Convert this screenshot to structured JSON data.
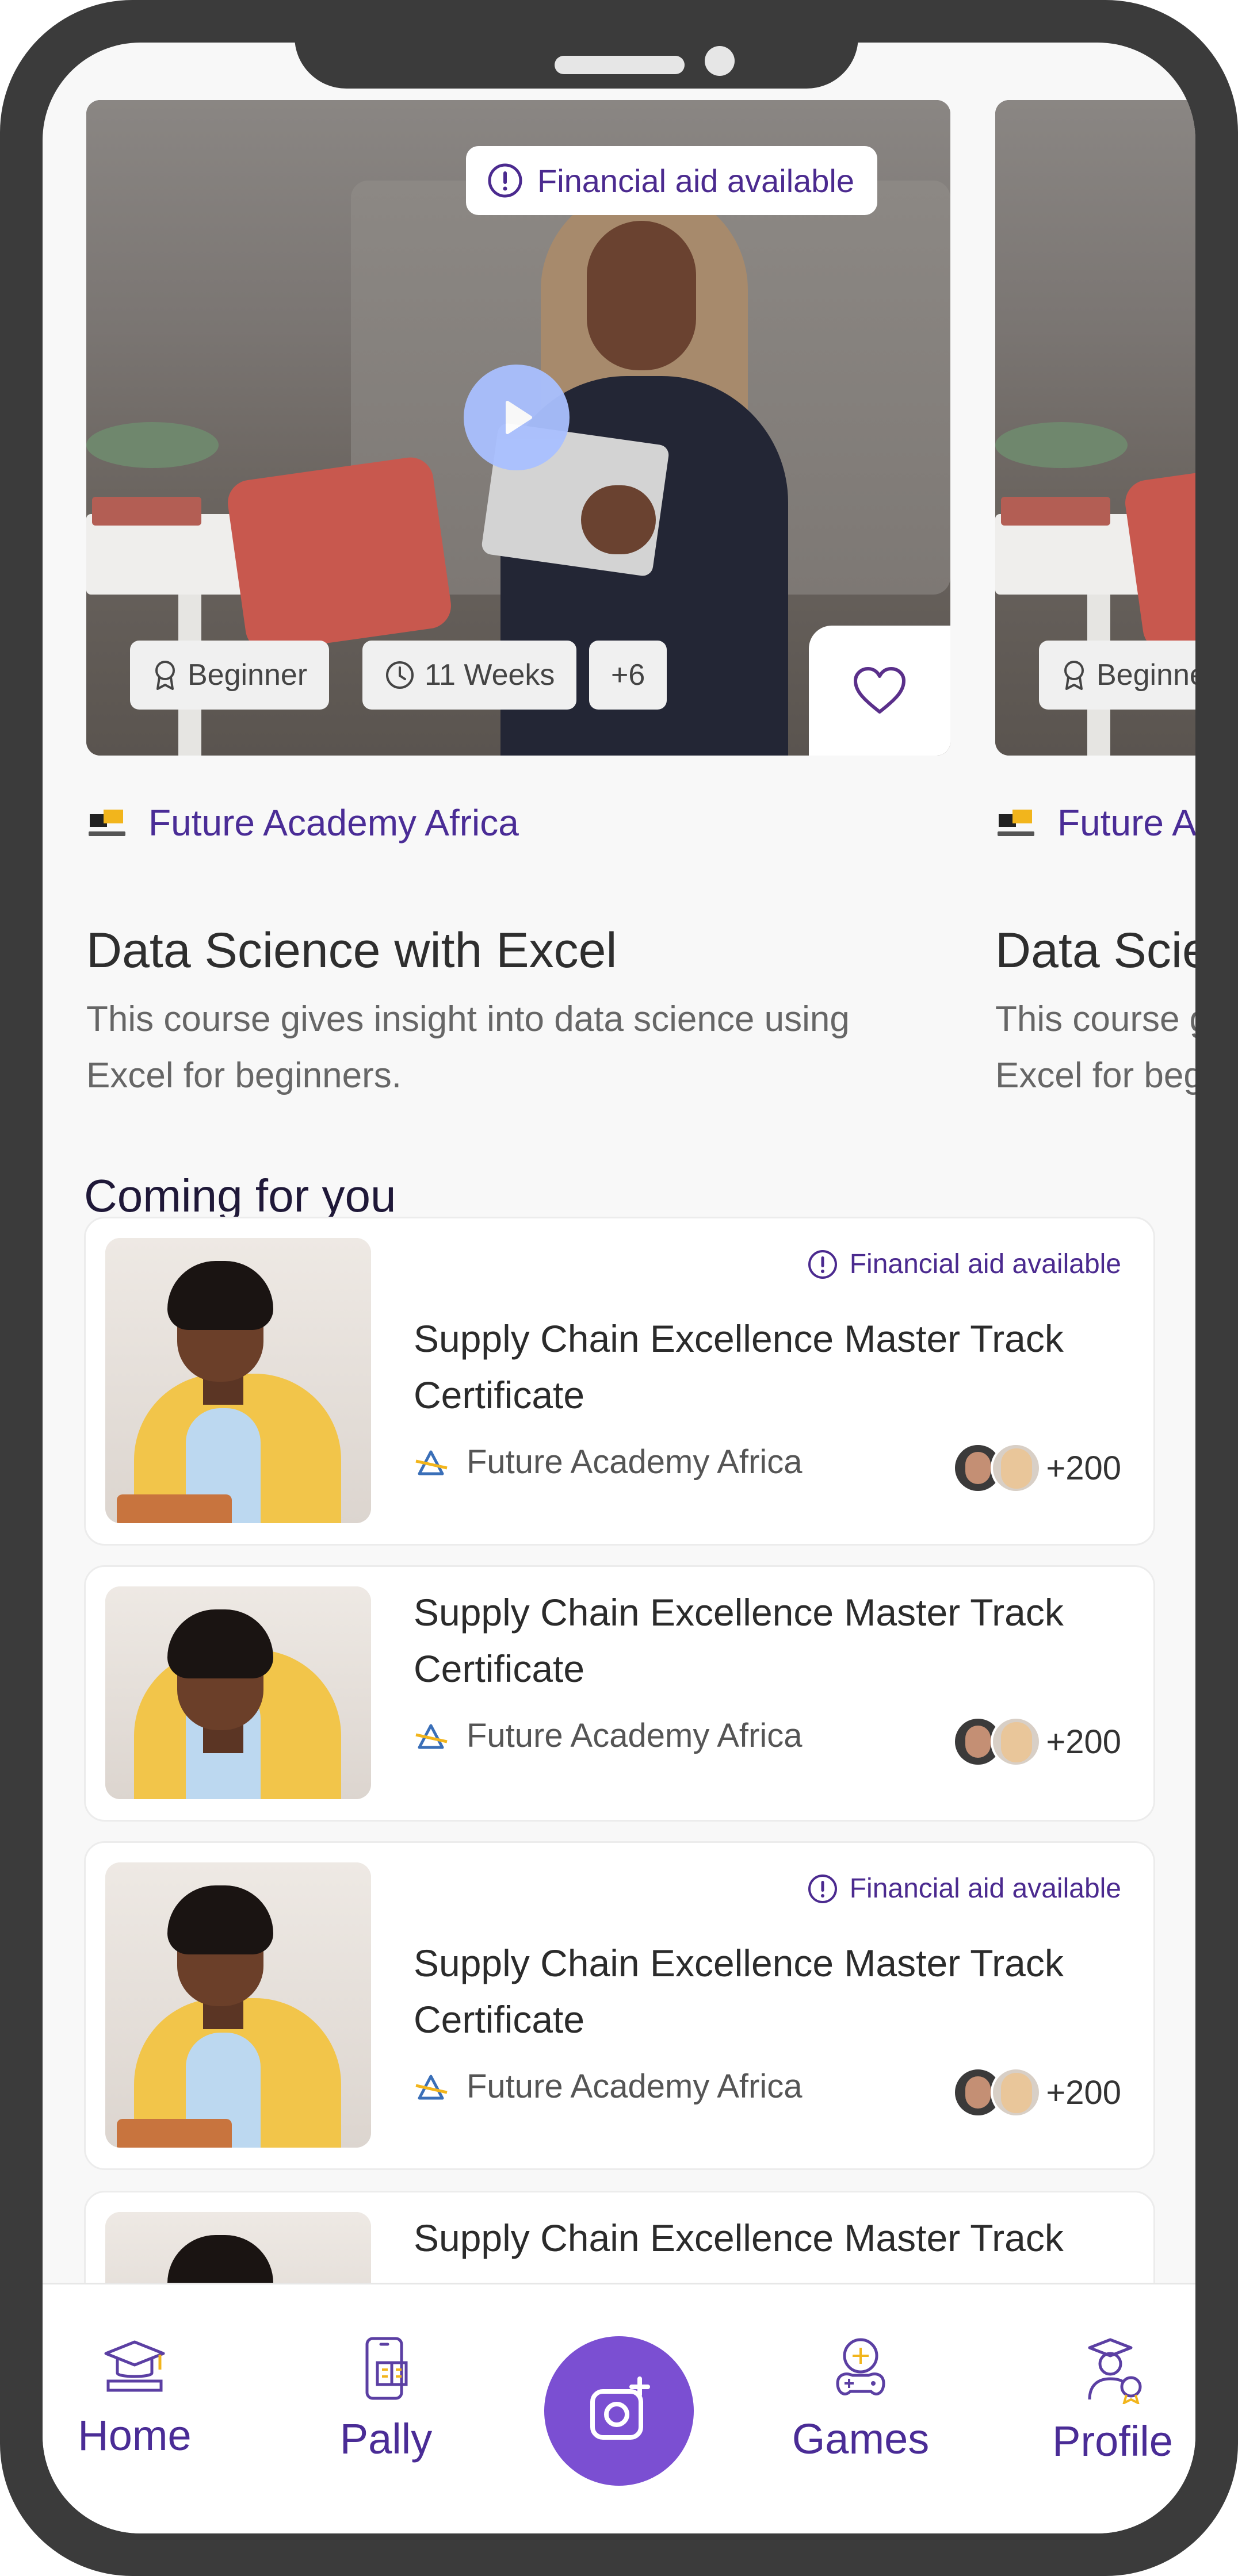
{
  "featured": [
    {
      "financial_aid": "Financial aid available",
      "tags": [
        "Beginner",
        "11 Weeks",
        "+6"
      ],
      "provider": "Future Academy Africa",
      "title": "Data Science with Excel",
      "description": "This course gives insight into data science using Excel for beginners."
    },
    {
      "tags": [
        "Beginner"
      ],
      "provider": "Future Academy Africa",
      "title": "Data Science with Excel",
      "description": "This course gives insight into data science using Excel for beginners."
    }
  ],
  "section": {
    "title": "Coming for you"
  },
  "list": [
    {
      "financial_aid": "Financial aid available",
      "title": "Supply Chain Excellence Master Track Certificate",
      "provider": "Future Academy Africa",
      "learners": "+200"
    },
    {
      "title": "Supply Chain Excellence Master Track Certificate",
      "provider": "Future Academy Africa",
      "learners": "+200"
    },
    {
      "financial_aid": "Financial aid available",
      "title": "Supply Chain Excellence Master Track Certificate",
      "provider": "Future Academy Africa",
      "learners": "+200"
    },
    {
      "title": "Supply Chain Excellence Master Track"
    }
  ],
  "nav": {
    "home": "Home",
    "pally": "Pally",
    "games": "Games",
    "profile": "Profile"
  },
  "colors": {
    "accent": "#4a2c96",
    "fab": "#7b4fd2",
    "play": "#a9c0ff",
    "frame": "#3b3b3b",
    "background": "#f8f8f8"
  },
  "icons": [
    "info-icon",
    "ribbon-icon",
    "clock-icon",
    "heart-icon",
    "play-icon",
    "graduation-cap-icon",
    "phone-book-icon",
    "camera-plus-icon",
    "game-controller-icon",
    "graduate-award-icon"
  ]
}
